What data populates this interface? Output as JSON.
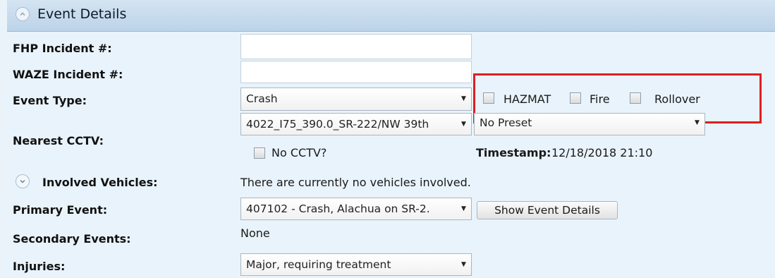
{
  "header": {
    "title": "Event Details"
  },
  "fields": {
    "fhp_incident": {
      "label": "FHP Incident #:",
      "value": ""
    },
    "waze_incident": {
      "label": "WAZE Incident #:",
      "value": ""
    },
    "event_type": {
      "label": "Event Type:",
      "value": "Crash"
    },
    "flags": {
      "hazmat": {
        "label": "HAZMAT",
        "checked": false
      },
      "fire": {
        "label": "Fire",
        "checked": false
      },
      "rollover": {
        "label": "Rollover",
        "checked": false
      }
    },
    "nearest_cctv": {
      "label": "Nearest CCTV:",
      "camera": "4022_I75_390.0_SR-222/NW 39th",
      "preset": "No Preset",
      "no_cctv_label": "No CCTV?",
      "timestamp_label": "Timestamp:",
      "timestamp_value": "12/18/2018 21:10"
    },
    "involved_vehicles": {
      "label": "Involved Vehicles:",
      "status": "There are currently no vehicles involved."
    },
    "primary_event": {
      "label": "Primary Event:",
      "value": "407102 - Crash, Alachua on SR-2.",
      "button_label": "Show Event Details"
    },
    "secondary_events": {
      "label": "Secondary Events:",
      "value": "None"
    },
    "injuries": {
      "label": "Injuries:",
      "value": "Major, requiring treatment"
    }
  },
  "colors": {
    "highlight": "#e01d24",
    "header": "#bcd3e8",
    "background": "#e9f3fb"
  },
  "icons": {
    "collapse": "chevron-up-icon",
    "expand": "chevron-down-icon",
    "dropdown": "caret-down-icon"
  }
}
